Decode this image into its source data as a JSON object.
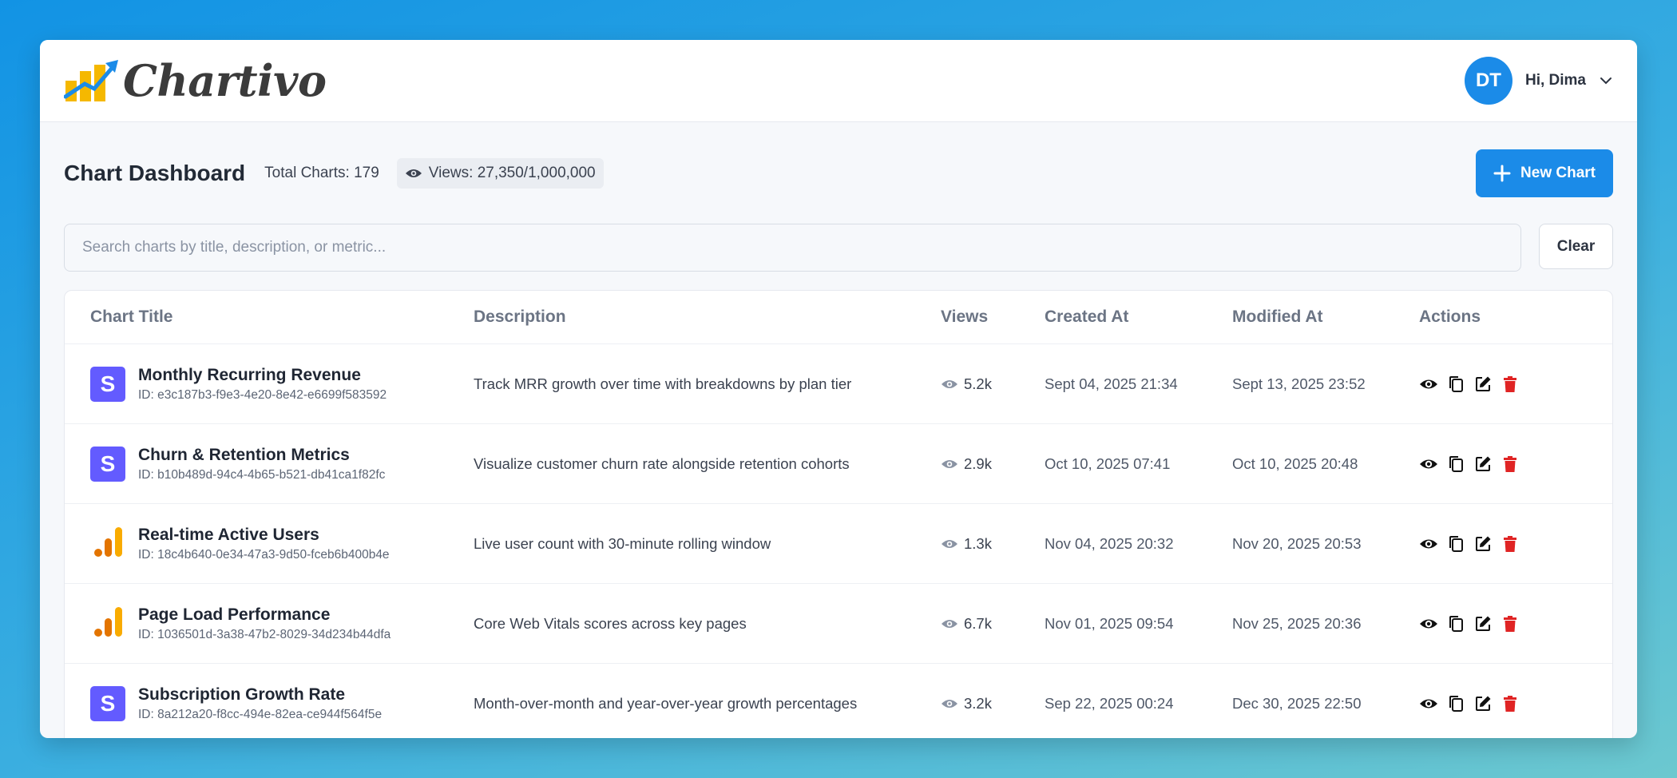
{
  "app": {
    "logo_text": "Chartivo",
    "user": {
      "initials": "DT",
      "greeting": "Hi, Dima"
    }
  },
  "dashboard": {
    "title": "Chart Dashboard",
    "total_charts": "Total Charts: 179",
    "views": "Views: 27,350/1,000,000",
    "new_chart_label": "New Chart"
  },
  "search": {
    "placeholder": "Search charts by title, description, or metric...",
    "value": "",
    "clear_label": "Clear"
  },
  "table": {
    "headers": {
      "title": "Chart Title",
      "description": "Description",
      "views": "Views",
      "created": "Created At",
      "modified": "Modified At",
      "actions": "Actions"
    },
    "rows": [
      {
        "icon": "stripe-s-icon",
        "icon_letter": "S",
        "title": "Monthly Recurring Revenue",
        "id": "ID: e3c187b3-f9e3-4e20-8e42-e6699f583592",
        "description": "Track MRR growth over time with breakdowns by plan tier",
        "views": "5.2k",
        "created": "Sept 04, 2025 21:34",
        "modified": "Sept 13, 2025 23:52"
      },
      {
        "icon": "stripe-s-icon",
        "icon_letter": "S",
        "title": "Churn & Retention Metrics",
        "id": "ID: b10b489d-94c4-4b65-b521-db41ca1f82fc",
        "description": "Visualize customer churn rate alongside retention cohorts",
        "views": "2.9k",
        "created": "Oct 10, 2025 07:41",
        "modified": "Oct 10, 2025 20:48"
      },
      {
        "icon": "analytics-bars-icon",
        "icon_letter": "",
        "title": "Real-time Active Users",
        "id": "ID: 18c4b640-0e34-47a3-9d50-fceb6b400b4e",
        "description": "Live user count with 30-minute rolling window",
        "views": "1.3k",
        "created": "Nov 04, 2025 20:32",
        "modified": "Nov 20, 2025 20:53"
      },
      {
        "icon": "analytics-bars-icon",
        "icon_letter": "",
        "title": "Page Load Performance",
        "id": "ID: 1036501d-3a38-47b2-8029-34d234b44dfa",
        "description": "Core Web Vitals scores across key pages",
        "views": "6.7k",
        "created": "Nov 01, 2025 09:54",
        "modified": "Nov 25, 2025 20:36"
      },
      {
        "icon": "stripe-s-icon",
        "icon_letter": "S",
        "title": "Subscription Growth Rate",
        "id": "ID: 8a212a20-f8cc-494e-82ea-ce944f564f5e",
        "description": "Month-over-month and year-over-year growth percentages",
        "views": "3.2k",
        "created": "Sep 22, 2025 00:24",
        "modified": "Dec 30, 2025 22:50"
      }
    ]
  },
  "colors": {
    "primary": "#1b8be8",
    "stripe": "#635bff",
    "delete": "#e02424",
    "analytics_orange": "#f5a623"
  }
}
